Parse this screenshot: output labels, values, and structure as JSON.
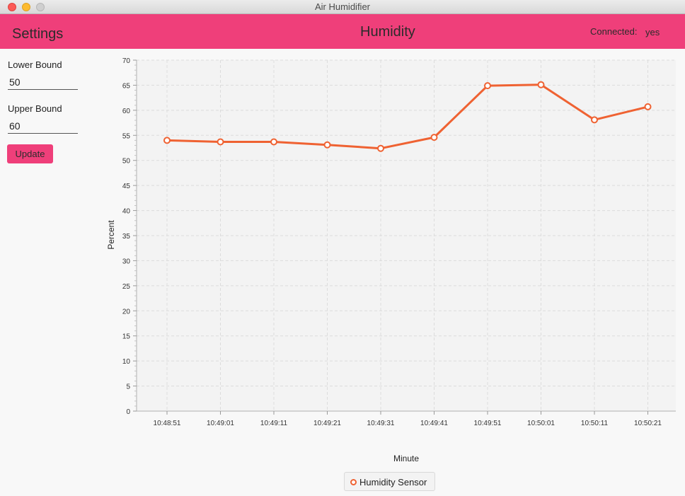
{
  "window": {
    "title": "Air Humidifier"
  },
  "header": {
    "settings_title": "Settings",
    "chart_title": "Humidity",
    "connected_label": "Connected:",
    "connected_value": "yes"
  },
  "settings": {
    "lower_bound_label": "Lower Bound",
    "lower_bound_value": "50",
    "upper_bound_label": "Upper Bound",
    "upper_bound_value": "60",
    "update_label": "Update"
  },
  "colors": {
    "accent": "#ef3f7a",
    "series": "#ef6232"
  },
  "chart_data": {
    "type": "line",
    "title": "Humidity",
    "xlabel": "Minute",
    "ylabel": "Percent",
    "ylim": [
      0,
      70
    ],
    "yticks": [
      0,
      5,
      10,
      15,
      20,
      25,
      30,
      35,
      40,
      45,
      50,
      55,
      60,
      65,
      70
    ],
    "grid": true,
    "legend": "bottom-center",
    "categories": [
      "10:48:51",
      "10:49:01",
      "10:49:11",
      "10:49:21",
      "10:49:31",
      "10:49:41",
      "10:49:51",
      "10:50:01",
      "10:50:11",
      "10:50:21"
    ],
    "series": [
      {
        "name": "Humidity Sensor",
        "values": [
          54.0,
          53.7,
          53.7,
          53.1,
          52.4,
          54.6,
          64.9,
          65.1,
          58.1,
          60.7
        ]
      }
    ]
  }
}
